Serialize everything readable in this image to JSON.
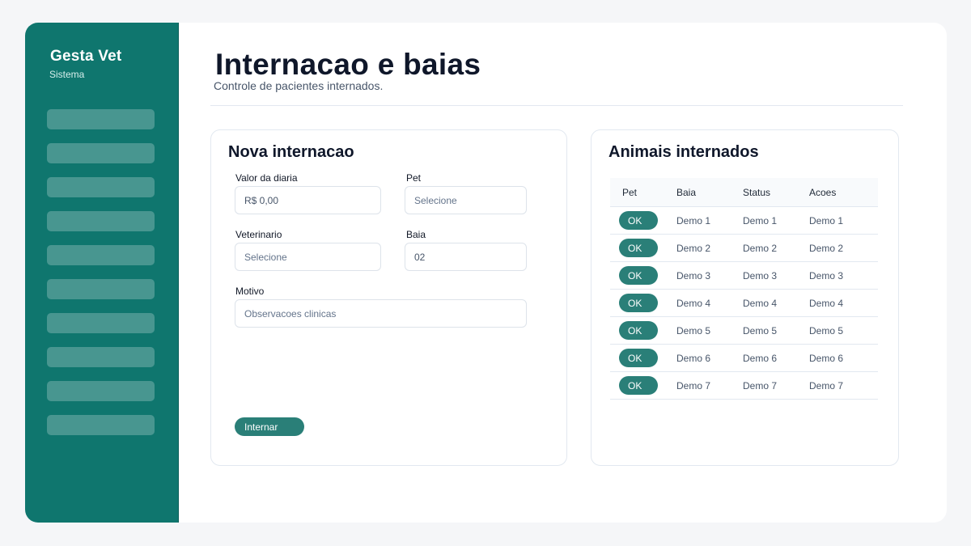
{
  "sidebar": {
    "brand": "Gesta Vet",
    "subtitle": "Sistema",
    "nav_item_count": 10
  },
  "header": {
    "title": "Internacao e baias",
    "subtitle": "Controle de pacientes internados."
  },
  "form": {
    "title": "Nova internacao",
    "valor_label": "Valor da diaria",
    "valor_value": "R$ 0,00",
    "pet_label": "Pet",
    "pet_placeholder": "Selecione",
    "vet_label": "Veterinario",
    "vet_placeholder": "Selecione",
    "baia_label": "Baia",
    "baia_value": "02",
    "motivo_label": "Motivo",
    "motivo_placeholder": "Observacoes clinicas",
    "submit_label": "Internar"
  },
  "table": {
    "title": "Animais internados",
    "headers": [
      "Pet",
      "Baia",
      "Status",
      "Acoes"
    ],
    "ok_label": "OK",
    "rows": [
      {
        "baia": "Demo 1",
        "status": "Demo 1",
        "acoes": "Demo 1"
      },
      {
        "baia": "Demo 2",
        "status": "Demo 2",
        "acoes": "Demo 2"
      },
      {
        "baia": "Demo 3",
        "status": "Demo 3",
        "acoes": "Demo 3"
      },
      {
        "baia": "Demo 4",
        "status": "Demo 4",
        "acoes": "Demo 4"
      },
      {
        "baia": "Demo 5",
        "status": "Demo 5",
        "acoes": "Demo 5"
      },
      {
        "baia": "Demo 6",
        "status": "Demo 6",
        "acoes": "Demo 6"
      },
      {
        "baia": "Demo 7",
        "status": "Demo 7",
        "acoes": "Demo 7"
      }
    ]
  },
  "colors": {
    "sidebar": "#0f766e",
    "button": "#2a7f78",
    "title": "#0f172a"
  }
}
